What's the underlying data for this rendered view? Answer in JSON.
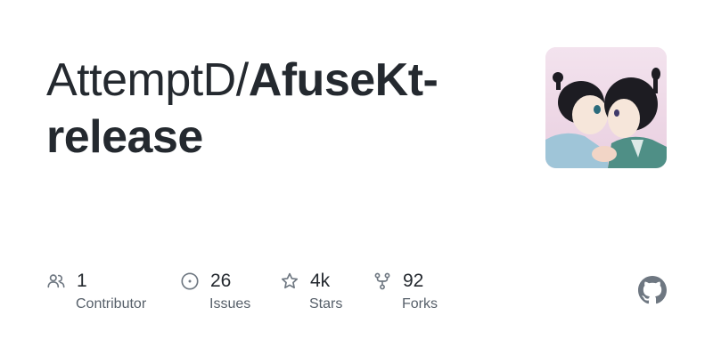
{
  "repo": {
    "owner": "AttemptD/",
    "name": "AfuseKt-",
    "name_cont": "release"
  },
  "avatar": {
    "description_icon": "anime-couple-avatar-image"
  },
  "stats": {
    "contributors": {
      "value": "1",
      "label": "Contributor",
      "icon": "people-icon"
    },
    "issues": {
      "value": "26",
      "label": "Issues",
      "icon": "issue-opened-icon"
    },
    "stars": {
      "value": "4k",
      "label": "Stars",
      "icon": "star-icon"
    },
    "forks": {
      "value": "92",
      "label": "Forks",
      "icon": "repo-forked-icon"
    }
  },
  "brand": {
    "logo_icon": "github-mark-icon",
    "text_color": "#24292f",
    "muted_color": "#57606a",
    "icon_color": "#6e7781"
  }
}
